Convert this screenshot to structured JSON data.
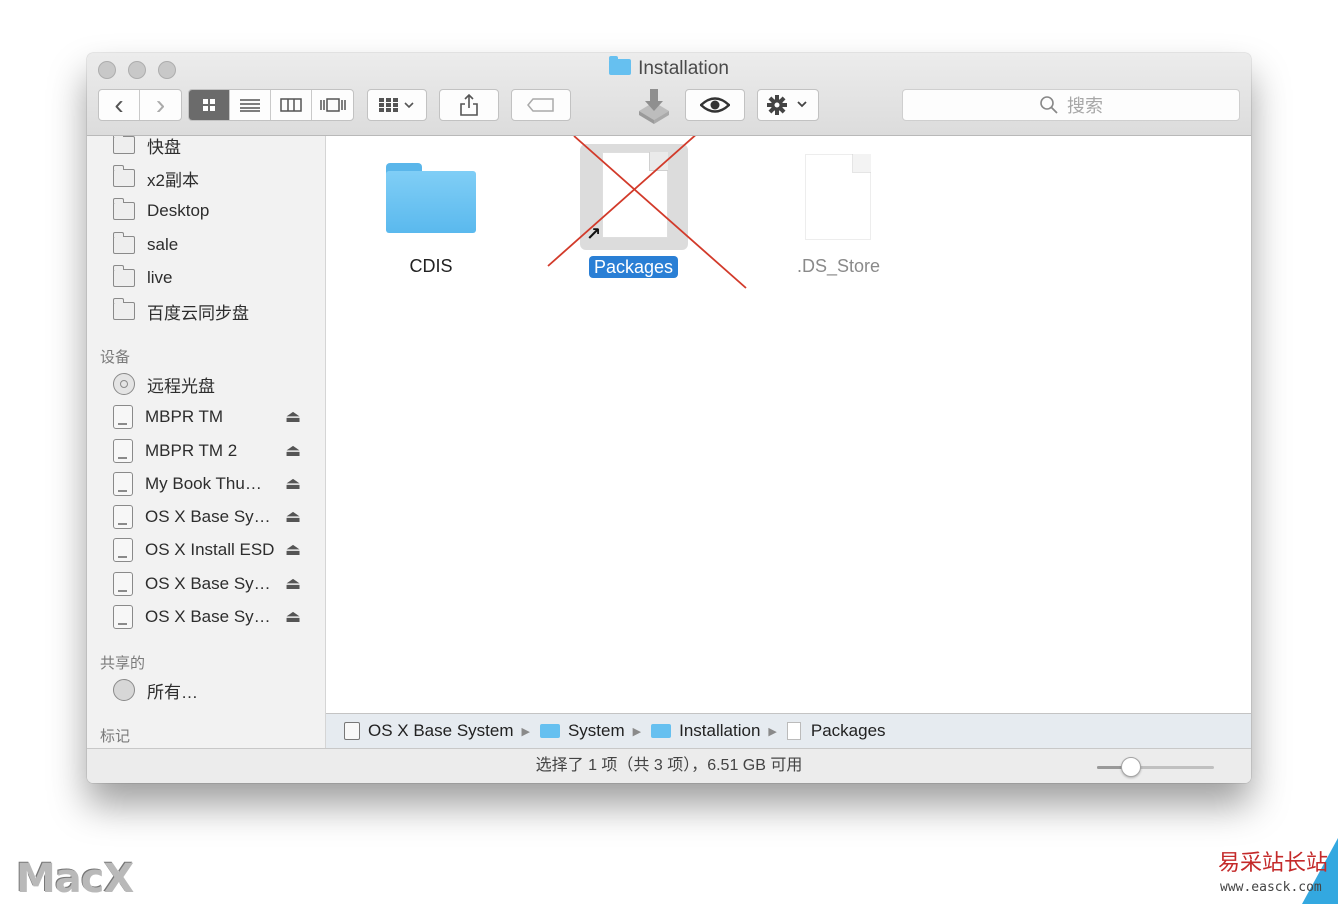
{
  "window": {
    "title": "Installation",
    "search_placeholder": "搜索"
  },
  "toolbar": {
    "back_glyph": "‹",
    "forward_glyph": "›",
    "view_modes": [
      "icon-view",
      "list-view",
      "column-view",
      "coverflow-view"
    ],
    "active_view": "icon-view"
  },
  "sidebar": {
    "favorites": [
      {
        "label": "快盘",
        "icon": "folder-icon"
      },
      {
        "label": "x2副本",
        "icon": "folder-icon"
      },
      {
        "label": "Desktop",
        "icon": "folder-icon"
      },
      {
        "label": "sale",
        "icon": "folder-icon"
      },
      {
        "label": "live",
        "icon": "folder-icon"
      },
      {
        "label": "百度云同步盘",
        "icon": "folder-icon"
      }
    ],
    "devices_header": "设备",
    "devices": [
      {
        "label": "远程光盘",
        "icon": "optical-disc-icon",
        "eject": false
      },
      {
        "label": "MBPR TM",
        "icon": "time-machine-disk-icon",
        "eject": true
      },
      {
        "label": "MBPR TM 2",
        "icon": "time-machine-disk-icon",
        "eject": true
      },
      {
        "label": "My Book Thu…",
        "icon": "external-disk-icon",
        "eject": true
      },
      {
        "label": "OS X Base Sy…",
        "icon": "external-disk-icon",
        "eject": true
      },
      {
        "label": "OS X Install ESD",
        "icon": "disk-icon",
        "eject": true
      },
      {
        "label": "OS X Base Sy…",
        "icon": "disk-icon",
        "eject": true
      },
      {
        "label": "OS X Base Sy…",
        "icon": "disk-icon",
        "eject": true
      }
    ],
    "shared_header": "共享的",
    "shared": [
      {
        "label": "所有…",
        "icon": "network-globe-icon"
      }
    ],
    "tags_header": "标记"
  },
  "files": [
    {
      "name": "CDIS",
      "kind": "folder",
      "selected": false
    },
    {
      "name": "Packages",
      "kind": "alias",
      "selected": true
    },
    {
      "name": ".DS_Store",
      "kind": "hidden-file",
      "selected": false
    }
  ],
  "pathbar": [
    {
      "label": "OS X Base System",
      "icon": "disk-icon"
    },
    {
      "label": "System",
      "icon": "folder-icon"
    },
    {
      "label": "Installation",
      "icon": "folder-icon"
    },
    {
      "label": "Packages",
      "icon": "alias-icon"
    }
  ],
  "status": {
    "text": "选择了 1 项（共 3 项），6.51 GB 可用",
    "icon_size_slider": 0.25
  },
  "watermarks": {
    "left": "MacX",
    "right": "易采站长站",
    "right_sub": "www.easck.com"
  },
  "colors": {
    "selection": "#2a7fd5",
    "folder": "#66c0f0",
    "annotation_cross": "#d23a2a"
  }
}
